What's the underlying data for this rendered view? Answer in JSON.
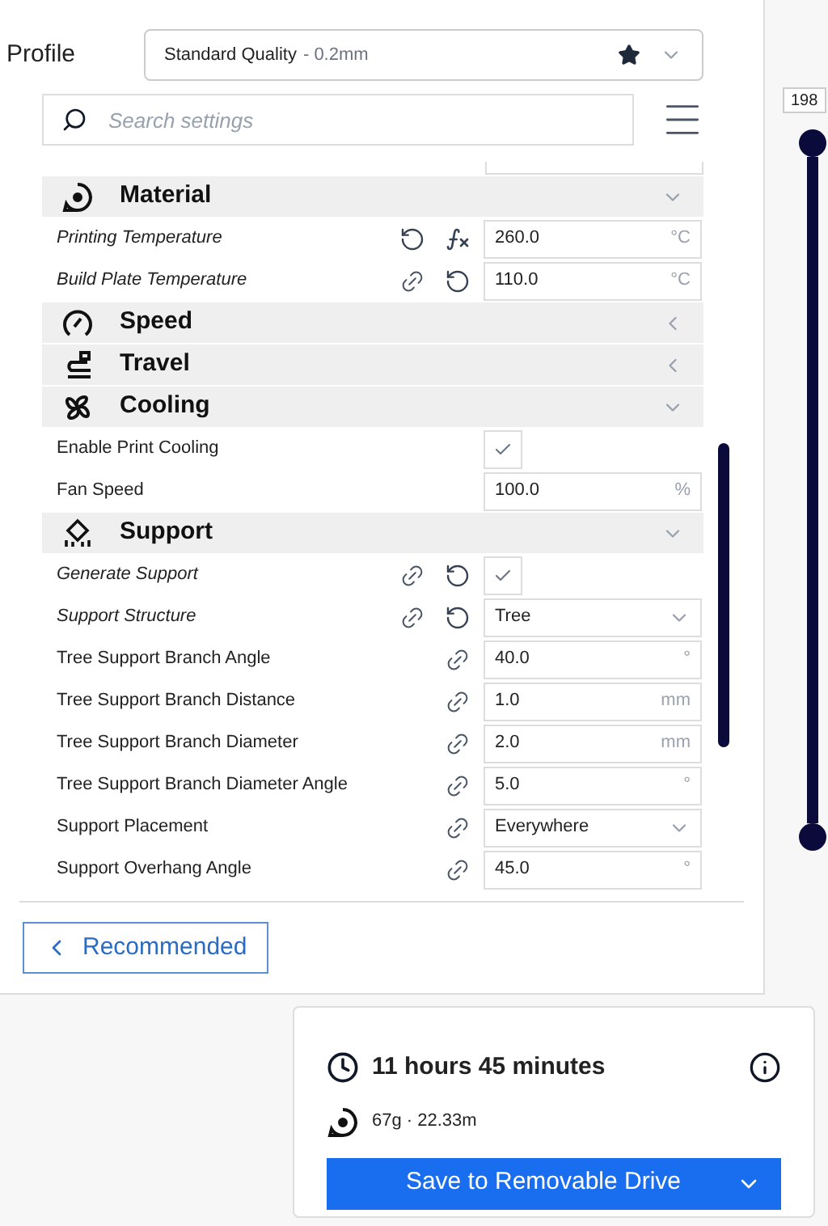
{
  "profile": {
    "label": "Profile",
    "quality": "Standard Quality",
    "layer_height": "- 0.2mm"
  },
  "search": {
    "placeholder": "Search settings"
  },
  "settings": [
    {
      "kind": "category",
      "label": "Material",
      "expanded": true
    },
    {
      "kind": "text",
      "label": "Printing Temperature",
      "changed": true,
      "linked": false,
      "resettable": true,
      "formula": true,
      "value": "260.0",
      "unit": "°C"
    },
    {
      "kind": "text",
      "label": "Build Plate Temperature",
      "changed": true,
      "linked": true,
      "resettable": true,
      "formula": false,
      "value": "110.0",
      "unit": "°C"
    },
    {
      "kind": "category",
      "label": "Speed",
      "expanded": false
    },
    {
      "kind": "category",
      "label": "Travel",
      "expanded": false
    },
    {
      "kind": "category",
      "label": "Cooling",
      "expanded": true
    },
    {
      "kind": "checkbox",
      "label": "Enable Print Cooling",
      "changed": false,
      "linked": false,
      "resettable": false,
      "formula": false,
      "checked": true
    },
    {
      "kind": "text",
      "label": "Fan Speed",
      "changed": false,
      "linked": false,
      "resettable": false,
      "formula": false,
      "value": "100.0",
      "unit": "%"
    },
    {
      "kind": "category",
      "label": "Support",
      "expanded": true
    },
    {
      "kind": "checkbox",
      "label": "Generate Support",
      "changed": true,
      "linked": true,
      "resettable": true,
      "formula": false,
      "checked": true
    },
    {
      "kind": "dropdown",
      "label": "Support Structure",
      "changed": true,
      "linked": true,
      "resettable": true,
      "formula": false,
      "value": "Tree"
    },
    {
      "kind": "text",
      "label": "Tree Support Branch Angle",
      "changed": false,
      "linked": true,
      "resettable": false,
      "formula": false,
      "value": "40.0",
      "unit": "°"
    },
    {
      "kind": "text",
      "label": "Tree Support Branch Distance",
      "changed": false,
      "linked": true,
      "resettable": false,
      "formula": false,
      "value": "1.0",
      "unit": "mm"
    },
    {
      "kind": "text",
      "label": "Tree Support Branch Diameter",
      "changed": false,
      "linked": true,
      "resettable": false,
      "formula": false,
      "value": "2.0",
      "unit": "mm"
    },
    {
      "kind": "text",
      "label": "Tree Support Branch Diameter Angle",
      "changed": false,
      "linked": true,
      "resettable": false,
      "formula": false,
      "value": "5.0",
      "unit": "°"
    },
    {
      "kind": "dropdown",
      "label": "Support Placement",
      "changed": false,
      "linked": true,
      "resettable": false,
      "formula": false,
      "value": "Everywhere"
    },
    {
      "kind": "text",
      "label": "Support Overhang Angle",
      "changed": false,
      "linked": true,
      "resettable": false,
      "formula": false,
      "value": "45.0",
      "unit": "°"
    }
  ],
  "recommended_button": {
    "label": "Recommended"
  },
  "layer_slider": {
    "label": "198"
  },
  "print_summary": {
    "time": "11 hours 45 minutes",
    "material": "67g · 22.33m",
    "save_button": "Save to Removable Drive"
  }
}
